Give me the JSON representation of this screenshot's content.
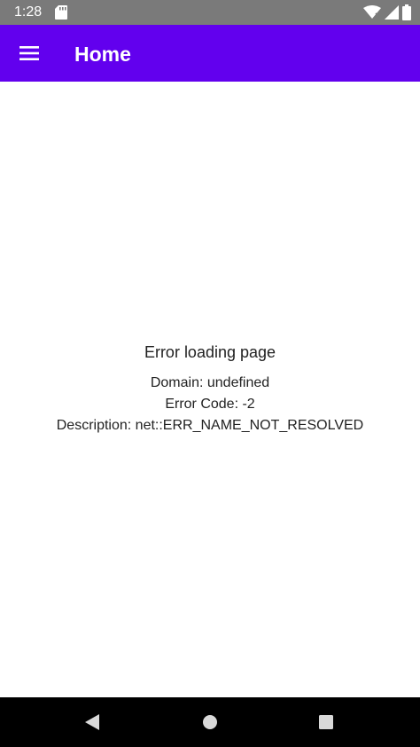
{
  "status_bar": {
    "time": "1:28",
    "icons": [
      "sd-card-icon",
      "wifi-icon",
      "signal-icon",
      "battery-icon"
    ]
  },
  "app_bar": {
    "title": "Home",
    "menu_icon": "hamburger-menu-icon",
    "background_color": "#6200ee"
  },
  "error": {
    "heading": "Error loading page",
    "domain": "Domain: undefined",
    "code": "Error Code: -2",
    "description": "Description: net::ERR_NAME_NOT_RESOLVED"
  },
  "nav_bar": {
    "icons": [
      "back-icon",
      "home-icon",
      "recents-icon"
    ]
  },
  "colors": {
    "status_bar": "#7a7a7a",
    "app_bar": "#6200ee",
    "nav_bar": "#000000",
    "text": "#222222"
  }
}
